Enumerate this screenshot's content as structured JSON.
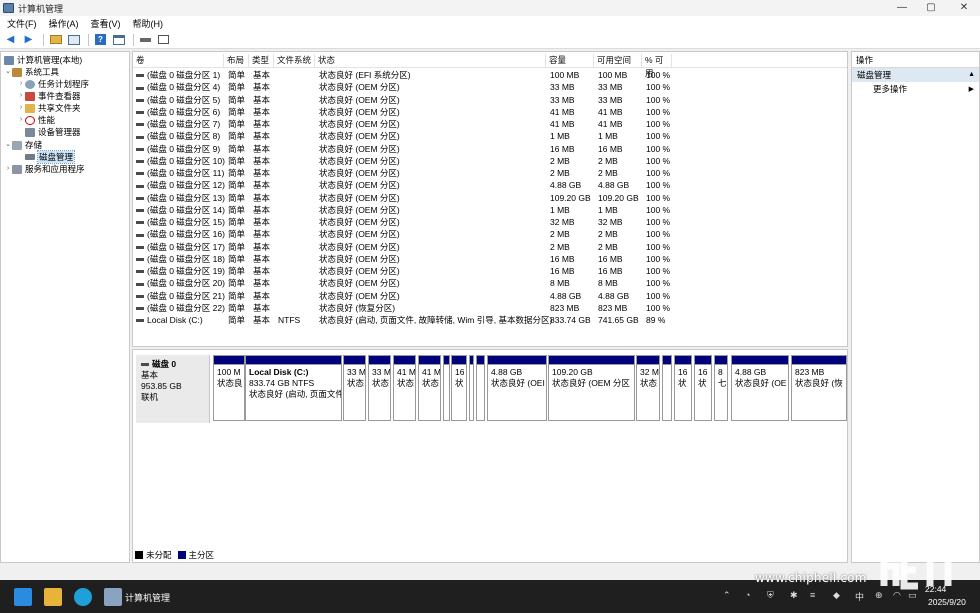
{
  "window": {
    "title": "计算机管理",
    "controls": [
      "—",
      "▢",
      "✕"
    ]
  },
  "menu": [
    "文件(F)",
    "操作(A)",
    "查看(V)",
    "帮助(H)"
  ],
  "toolbar_icons": [
    "back-icon",
    "forward-icon",
    "up-folder-icon",
    "console-tree-icon",
    "help-icon",
    "properties-icon",
    "connect-icon",
    "list-view-icon"
  ],
  "tree": {
    "root": "计算机管理(本地)",
    "system_tools": "系统工具",
    "task_scheduler": "任务计划程序",
    "event_viewer": "事件查看器",
    "shared_folders": "共享文件夹",
    "performance": "性能",
    "device_manager": "设备管理器",
    "storage": "存储",
    "disk_management": "磁盘管理",
    "services": "服务和应用程序"
  },
  "columns": [
    "卷",
    "布局",
    "类型",
    "文件系统",
    "状态",
    "容量",
    "可用空间",
    "% 可用"
  ],
  "volumes": [
    [
      "(磁盘 0 磁盘分区 1)",
      "简单",
      "基本",
      "",
      "状态良好 (EFI 系统分区)",
      "100 MB",
      "100 MB",
      "100 %"
    ],
    [
      "(磁盘 0 磁盘分区 4)",
      "简单",
      "基本",
      "",
      "状态良好 (OEM 分区)",
      "33 MB",
      "33 MB",
      "100 %"
    ],
    [
      "(磁盘 0 磁盘分区 5)",
      "简单",
      "基本",
      "",
      "状态良好 (OEM 分区)",
      "33 MB",
      "33 MB",
      "100 %"
    ],
    [
      "(磁盘 0 磁盘分区 6)",
      "简单",
      "基本",
      "",
      "状态良好 (OEM 分区)",
      "41 MB",
      "41 MB",
      "100 %"
    ],
    [
      "(磁盘 0 磁盘分区 7)",
      "简单",
      "基本",
      "",
      "状态良好 (OEM 分区)",
      "41 MB",
      "41 MB",
      "100 %"
    ],
    [
      "(磁盘 0 磁盘分区 8)",
      "简单",
      "基本",
      "",
      "状态良好 (OEM 分区)",
      "1 MB",
      "1 MB",
      "100 %"
    ],
    [
      "(磁盘 0 磁盘分区 9)",
      "简单",
      "基本",
      "",
      "状态良好 (OEM 分区)",
      "16 MB",
      "16 MB",
      "100 %"
    ],
    [
      "(磁盘 0 磁盘分区 10)",
      "简单",
      "基本",
      "",
      "状态良好 (OEM 分区)",
      "2 MB",
      "2 MB",
      "100 %"
    ],
    [
      "(磁盘 0 磁盘分区 11)",
      "简单",
      "基本",
      "",
      "状态良好 (OEM 分区)",
      "2 MB",
      "2 MB",
      "100 %"
    ],
    [
      "(磁盘 0 磁盘分区 12)",
      "简单",
      "基本",
      "",
      "状态良好 (OEM 分区)",
      "4.88 GB",
      "4.88 GB",
      "100 %"
    ],
    [
      "(磁盘 0 磁盘分区 13)",
      "简单",
      "基本",
      "",
      "状态良好 (OEM 分区)",
      "109.20 GB",
      "109.20 GB",
      "100 %"
    ],
    [
      "(磁盘 0 磁盘分区 14)",
      "简单",
      "基本",
      "",
      "状态良好 (OEM 分区)",
      "1 MB",
      "1 MB",
      "100 %"
    ],
    [
      "(磁盘 0 磁盘分区 15)",
      "简单",
      "基本",
      "",
      "状态良好 (OEM 分区)",
      "32 MB",
      "32 MB",
      "100 %"
    ],
    [
      "(磁盘 0 磁盘分区 16)",
      "简单",
      "基本",
      "",
      "状态良好 (OEM 分区)",
      "2 MB",
      "2 MB",
      "100 %"
    ],
    [
      "(磁盘 0 磁盘分区 17)",
      "简单",
      "基本",
      "",
      "状态良好 (OEM 分区)",
      "2 MB",
      "2 MB",
      "100 %"
    ],
    [
      "(磁盘 0 磁盘分区 18)",
      "简单",
      "基本",
      "",
      "状态良好 (OEM 分区)",
      "16 MB",
      "16 MB",
      "100 %"
    ],
    [
      "(磁盘 0 磁盘分区 19)",
      "简单",
      "基本",
      "",
      "状态良好 (OEM 分区)",
      "16 MB",
      "16 MB",
      "100 %"
    ],
    [
      "(磁盘 0 磁盘分区 20)",
      "简单",
      "基本",
      "",
      "状态良好 (OEM 分区)",
      "8 MB",
      "8 MB",
      "100 %"
    ],
    [
      "(磁盘 0 磁盘分区 21)",
      "简单",
      "基本",
      "",
      "状态良好 (OEM 分区)",
      "4.88 GB",
      "4.88 GB",
      "100 %"
    ],
    [
      "(磁盘 0 磁盘分区 22)",
      "简单",
      "基本",
      "",
      "状态良好 (恢复分区)",
      "823 MB",
      "823 MB",
      "100 %"
    ],
    [
      "Local Disk (C:)",
      "简单",
      "基本",
      "NTFS",
      "状态良好 (启动, 页面文件, 故障转储, Wim 引导, 基本数据分区)",
      "833.74 GB",
      "741.65 GB",
      "89 %"
    ]
  ],
  "disk": {
    "name": "磁盘 0",
    "type": "基本",
    "size": "953.85 GB",
    "status": "联机"
  },
  "partitions": [
    {
      "l1": "",
      "l2": "100 M",
      "l3": "状态良"
    },
    {
      "l1": "Local Disk  (C:)",
      "l2": "833.74 GB NTFS",
      "l3": "状态良好 (启动, 页面文件"
    },
    {
      "l1": "",
      "l2": "33 M",
      "l3": "状态"
    },
    {
      "l1": "",
      "l2": "33 M",
      "l3": "状态"
    },
    {
      "l1": "",
      "l2": "41 M",
      "l3": "状态"
    },
    {
      "l1": "",
      "l2": "41 M",
      "l3": "状态"
    },
    {
      "l1": "",
      "l2": "",
      "l3": ""
    },
    {
      "l1": "",
      "l2": "16",
      "l3": "状"
    },
    {
      "l1": "",
      "l2": "",
      "l3": ""
    },
    {
      "l1": "",
      "l2": "",
      "l3": ""
    },
    {
      "l1": "",
      "l2": "4.88 GB",
      "l3": "状态良好 (OEI"
    },
    {
      "l1": "",
      "l2": "109.20 GB",
      "l3": "状态良好 (OEM 分区"
    },
    {
      "l1": "",
      "l2": "32 M",
      "l3": "状态"
    },
    {
      "l1": "",
      "l2": "",
      "l3": ""
    },
    {
      "l1": "",
      "l2": "16",
      "l3": "状"
    },
    {
      "l1": "",
      "l2": "16",
      "l3": "状"
    },
    {
      "l1": "",
      "l2": "8",
      "l3": "七"
    },
    {
      "l1": "",
      "l2": "4.88 GB",
      "l3": "状态良好 (OE"
    },
    {
      "l1": "",
      "l2": "823 MB",
      "l3": "状态良好 (恢"
    }
  ],
  "legend": {
    "unallocated": "未分配",
    "primary": "主分区",
    "unallocated_color": "#000000",
    "primary_color": "#00007a"
  },
  "actions": {
    "header": "操作",
    "section": "磁盘管理",
    "more": "更多操作"
  },
  "taskbar": {
    "app_label": "计算机管理",
    "ime": "中",
    "time": "22:44",
    "date": "2025/9/20"
  },
  "watermark": {
    "url": "www.chiphell.com",
    "logo": "chip hell"
  }
}
